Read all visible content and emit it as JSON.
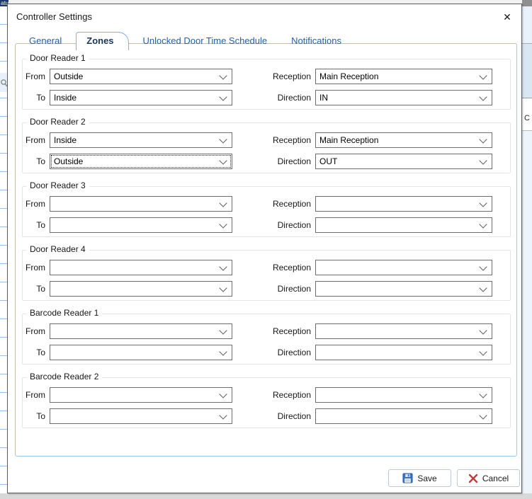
{
  "background": {
    "left_window": {
      "header_text_fragment": "atu"
    },
    "right_window": {
      "header_text_fragment": "C"
    }
  },
  "dialog": {
    "title": "Controller Settings",
    "close_glyph": "✕"
  },
  "tabs": [
    {
      "label": "General",
      "active": false
    },
    {
      "label": "Zones",
      "active": true
    },
    {
      "label": "Unlocked Door Time Schedule",
      "active": false
    },
    {
      "label": "Notifications",
      "active": false
    }
  ],
  "field_labels": {
    "from": "From",
    "to": "To",
    "reception": "Reception",
    "direction": "Direction"
  },
  "sections": [
    {
      "title": "Door Reader 1",
      "from": "Outside",
      "to": "Inside",
      "reception": "Main Reception",
      "direction": "IN",
      "focused_field": ""
    },
    {
      "title": "Door Reader 2",
      "from": "Inside",
      "to": "Outside",
      "reception": "Main Reception",
      "direction": "OUT",
      "focused_field": "to"
    },
    {
      "title": "Door Reader 3",
      "from": "",
      "to": "",
      "reception": "",
      "direction": "",
      "focused_field": ""
    },
    {
      "title": "Door Reader 4",
      "from": "",
      "to": "",
      "reception": "",
      "direction": "",
      "focused_field": ""
    },
    {
      "title": "Barcode Reader 1",
      "from": "",
      "to": "",
      "reception": "",
      "direction": "",
      "focused_field": ""
    },
    {
      "title": "Barcode Reader 2",
      "from": "",
      "to": "",
      "reception": "",
      "direction": "",
      "focused_field": ""
    }
  ],
  "buttons": {
    "save": "Save",
    "cancel": "Cancel"
  },
  "icons": {
    "close": "x-icon",
    "save": "floppy-disk-icon",
    "cancel": "red-x-icon",
    "combo": "chevron-down-icon",
    "left_row": "magnifier-icon"
  },
  "colors": {
    "tab_text": "#2b5ca8",
    "tab_active_text": "#17365d",
    "tab_border": "#8ab1dd",
    "panel_border": "#a3c3e3",
    "combo_border": "#6e6e6e",
    "save_icon_blue": "#3a72c4",
    "cancel_x_red": "#c23b3b",
    "bg_header_navy": "#17386e"
  }
}
